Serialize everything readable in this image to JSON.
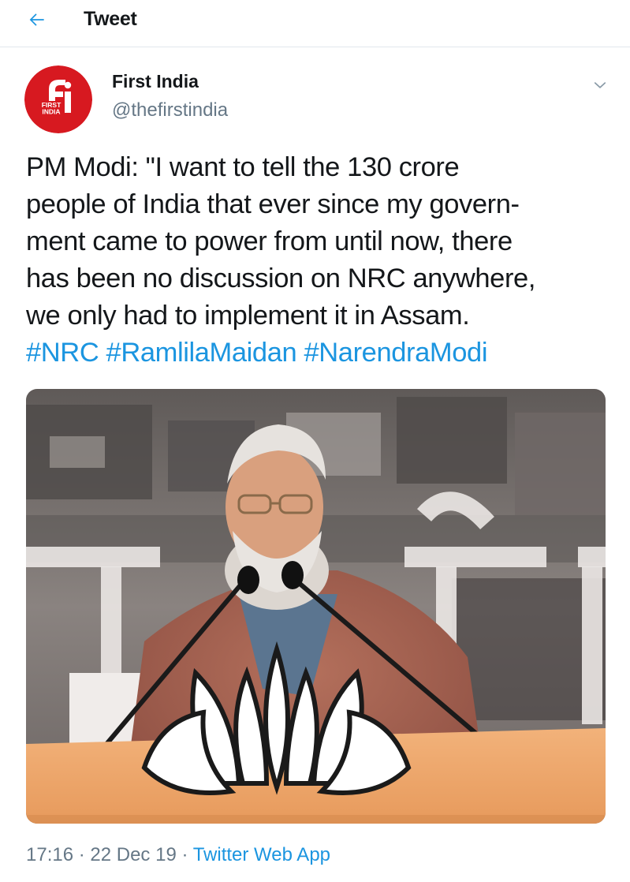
{
  "header": {
    "title": "Tweet",
    "back_icon": "arrow-left-icon",
    "accent": "#1b95e0"
  },
  "author": {
    "name": "First India",
    "handle": "@thefirstindia",
    "avatar_logo_text": "FIRST INDIA",
    "avatar_logo_colors": {
      "red": "#d71920",
      "white": "#ffffff"
    },
    "menu_icon": "chevron-down-icon"
  },
  "tweet": {
    "lines": [
      "PM Modi: \"I want to tell the 130 crore",
      "people of India that ever since my govern-",
      "ment came to power from until now, there",
      "has been no discussion on NRC anywhere,",
      "we only had to implement it in Assam."
    ],
    "hashtags": [
      "#NRC",
      "#RamlilaMaidan",
      "#NarendraModi"
    ],
    "hashtag_color": "#1b95e0"
  },
  "media": {
    "type": "photo"
  },
  "meta": {
    "time": "17:16",
    "separator": " · ",
    "date": "22 Dec 19",
    "source": "Twitter Web App"
  },
  "colors": {
    "text": "#14171a",
    "secondary": "#657786",
    "divider": "#e1e8ed",
    "link": "#1b95e0"
  }
}
